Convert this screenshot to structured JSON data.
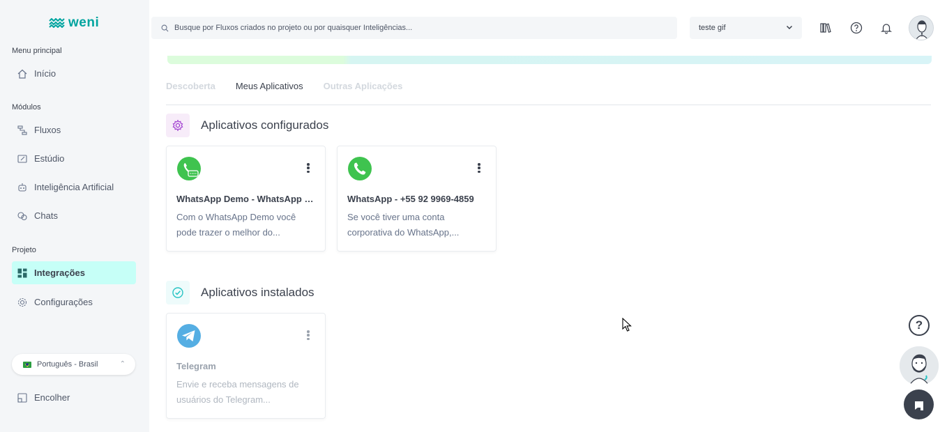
{
  "brand": {
    "name": "weni",
    "accent": "#00a49f"
  },
  "sidebar": {
    "sections": [
      {
        "title": "Menu principal",
        "items": [
          {
            "label": "Início",
            "icon": "home-icon"
          }
        ]
      },
      {
        "title": "Módulos",
        "items": [
          {
            "label": "Fluxos",
            "icon": "flow-icon"
          },
          {
            "label": "Estúdio",
            "icon": "studio-icon"
          },
          {
            "label": "Inteligência Artificial",
            "icon": "robot-icon"
          },
          {
            "label": "Chats",
            "icon": "chat-icon"
          }
        ]
      },
      {
        "title": "Projeto",
        "items": [
          {
            "label": "Integrações",
            "icon": "integrations-icon",
            "active": true
          },
          {
            "label": "Configurações",
            "icon": "gear-icon"
          }
        ]
      }
    ],
    "language": "Português - Brasil",
    "collapse_label": "Encolher"
  },
  "header": {
    "search_placeholder": "Busque por Fluxos criados no projeto ou por quaisquer Inteligências...",
    "project": "teste gif"
  },
  "tabs": [
    {
      "label": "Descoberta",
      "active": false
    },
    {
      "label": "Meus Aplicativos",
      "active": true
    },
    {
      "label": "Outras Aplicações",
      "active": false
    }
  ],
  "configured": {
    "title": "Aplicativos configurados",
    "apps": [
      {
        "name": "WhatsApp Demo - WhatsApp Demo",
        "desc": "Com o WhatsApp Demo você pode trazer o melhor do...",
        "icon": "whatsapp-demo-icon"
      },
      {
        "name": "WhatsApp - +55 92 9969-4859",
        "desc": "Se você tiver uma conta corporativa do WhatsApp,...",
        "icon": "whatsapp-icon"
      }
    ]
  },
  "installed": {
    "title": "Aplicativos instalados",
    "apps": [
      {
        "name": "Telegram",
        "desc": "Envie e receba mensagens de usuários do Telegram...",
        "icon": "telegram-icon"
      }
    ]
  },
  "floating": {
    "help": "?"
  }
}
